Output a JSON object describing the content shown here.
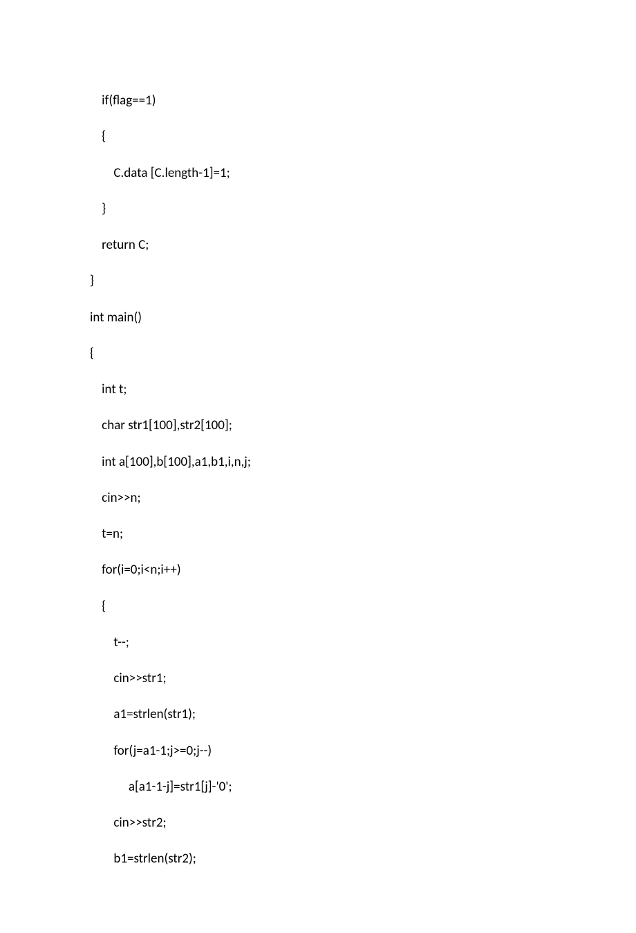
{
  "code_lines": [
    "    if(flag==1)",
    "    {",
    "        C.data [C.length-1]=1;",
    "    }",
    "    return C;",
    "}",
    "int main()",
    "{",
    "    int t;",
    "    char str1[100],str2[100];",
    "    int a[100],b[100],a1,b1,i,n,j;",
    "    cin>>n;",
    "    t=n;",
    "    for(i=0;i<n;i++)",
    "    {",
    "        t--;",
    "        cin>>str1;",
    "        a1=strlen(str1);",
    "        for(j=a1-1;j>=0;j--)",
    "             a[a1-1-j]=str1[j]-'0';",
    "        cin>>str2;",
    "        b1=strlen(str2);"
  ]
}
